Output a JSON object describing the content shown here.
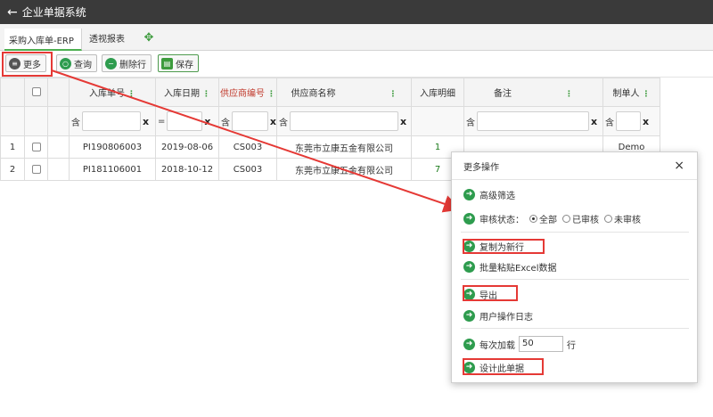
{
  "window": {
    "back_icon": "arrow-left-icon",
    "title": "企业单据系统"
  },
  "tabs": [
    {
      "label": "采购入库单-ERP",
      "active": true
    },
    {
      "label": "透视报表",
      "active": false
    }
  ],
  "tab_icon": "move-arrows-icon",
  "toolbar": {
    "more": "更多",
    "query": "查询",
    "delete_row": "删除行",
    "save": "保存"
  },
  "table": {
    "columns": [
      {
        "label": "入库单号"
      },
      {
        "label": "入库日期"
      },
      {
        "label": "供应商编号",
        "color": "#c0392b"
      },
      {
        "label": "供应商名称"
      },
      {
        "label": "入库明细"
      },
      {
        "label": "备注"
      },
      {
        "label": "制单人"
      }
    ],
    "filters": [
      "含",
      "=",
      "含",
      "含",
      "含",
      "含"
    ],
    "clear": "x",
    "rows": [
      {
        "num": "1",
        "order_no": "PI190806003",
        "date": "2019-08-06",
        "supplier_code": "CS003",
        "supplier_name": "东莞市立康五金有限公司",
        "detail": "1",
        "remark": "",
        "maker": "Demo"
      },
      {
        "num": "2",
        "order_no": "PI181106001",
        "date": "2018-10-12",
        "supplier_code": "CS003",
        "supplier_name": "东莞市立康五金有限公司",
        "detail": "7",
        "remark": "",
        "maker": ""
      }
    ]
  },
  "modal": {
    "title": "更多操作",
    "close": "×",
    "advanced_filter": "高级筛选",
    "audit_label": "审核状态：",
    "audit_options": [
      "全部",
      "已审核",
      "未审核"
    ],
    "copy_new_row": "复制为新行",
    "batch_paste": "批量粘贴Excel数据",
    "export": "导出",
    "user_log": "用户操作日志",
    "load_prefix": "每次加载",
    "load_value": "50",
    "load_suffix": "行",
    "design": "设计此单据"
  },
  "colors": {
    "accent": "#3d9b3d",
    "highlight": "#e53935",
    "titlebar": "#3a3a3a"
  }
}
